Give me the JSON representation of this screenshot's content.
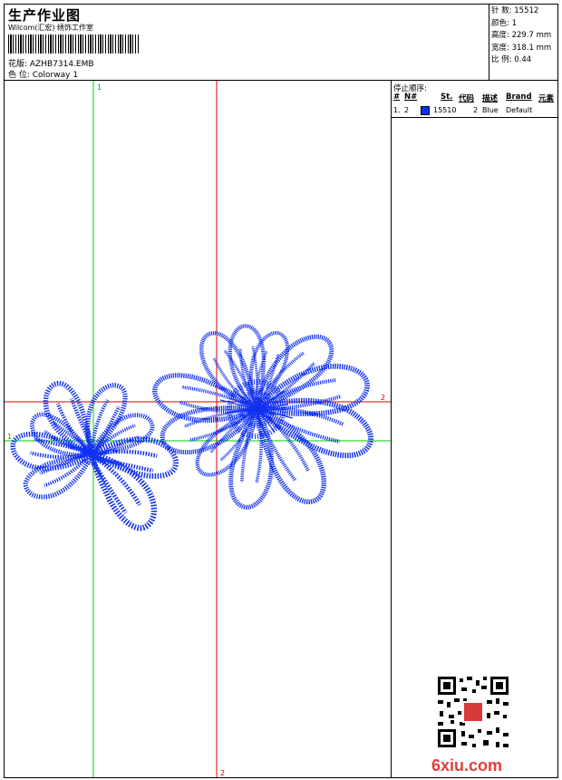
{
  "header": {
    "title": "生产作业图",
    "company": "Wilcom(汇宏) 绣饰工作室",
    "pattern": "花版: AZHB7314.EMB",
    "colorway": "色 位: Colorway 1"
  },
  "info": {
    "stitches": "针 数: 15512",
    "colors": "颜色: 1",
    "height": "高度: 229.7 mm",
    "width": "宽度: 318.1 mm",
    "scale": "比 例: 0.44"
  },
  "stop_sequence": {
    "title": "停止顺序:",
    "headers": {
      "idx": "#",
      "n": "N#",
      "st": "St.",
      "code": "代码",
      "desc": "描述",
      "brand": "Brand",
      "elem": "元素"
    },
    "row": {
      "idx": "1.",
      "n": "2",
      "st": "15510",
      "code": "2",
      "desc": "Blue",
      "brand": "Default"
    }
  },
  "markers": {
    "green_top": "1",
    "green_left": "1",
    "red_bottom": "2",
    "red_right": "2"
  },
  "brand_mark": "6xiu.com",
  "colors": {
    "thread": "#1030f0",
    "guide_green": "#00cc00",
    "guide_red": "#dd0000",
    "brand_red": "#e43d3a"
  }
}
